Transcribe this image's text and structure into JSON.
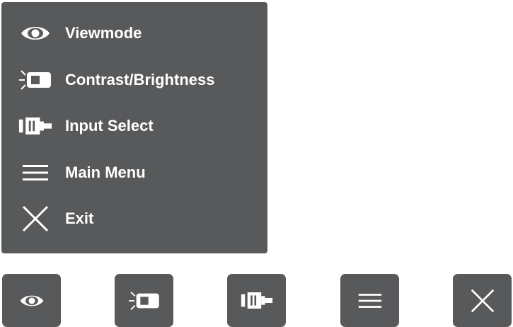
{
  "menu": {
    "items": [
      {
        "label": "Viewmode",
        "icon": "eye-icon"
      },
      {
        "label": "Contrast/Brightness",
        "icon": "brightness-icon"
      },
      {
        "label": "Input Select",
        "icon": "input-select-icon"
      },
      {
        "label": "Main Menu",
        "icon": "hamburger-menu-icon"
      },
      {
        "label": "Exit",
        "icon": "close-icon"
      }
    ]
  },
  "keys": [
    {
      "icon": "eye-icon"
    },
    {
      "icon": "brightness-icon"
    },
    {
      "icon": "input-select-icon"
    },
    {
      "icon": "hamburger-menu-icon"
    },
    {
      "icon": "close-icon"
    }
  ],
  "colors": {
    "panel_background": "#58595b",
    "foreground": "#ffffff",
    "page_background": "#ffffff"
  }
}
